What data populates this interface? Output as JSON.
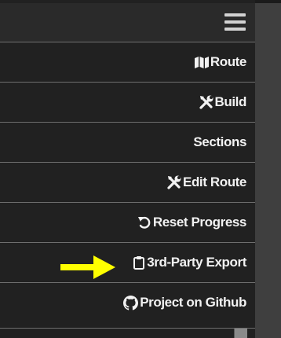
{
  "colors": {
    "panel_bg": "#212121",
    "header_bg": "#2a2a2a",
    "text": "#f2f2f2",
    "divider": "#6e6e6e",
    "annotation_arrow": "#ffff00"
  },
  "header": {
    "menu_icon": "hamburger-menu-icon"
  },
  "menu": {
    "items": [
      {
        "label": "Route",
        "icon": "map-icon"
      },
      {
        "label": "Build",
        "icon": "tools-icon"
      },
      {
        "label": "Sections",
        "icon": ""
      },
      {
        "label": "Edit Route",
        "icon": "tools-icon"
      },
      {
        "label": "Reset Progress",
        "icon": "undo-icon"
      },
      {
        "label": "3rd-Party Export",
        "icon": "clipboard-icon"
      },
      {
        "label": "Project on Github",
        "icon": "github-icon"
      }
    ]
  }
}
